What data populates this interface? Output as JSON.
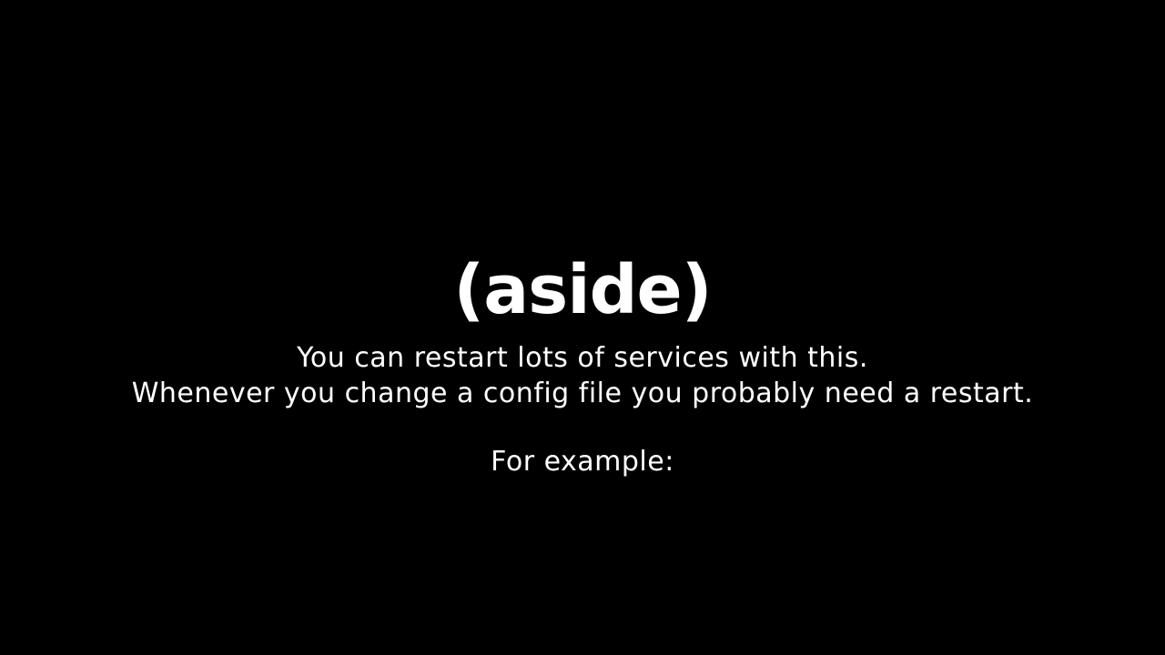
{
  "slide": {
    "title": "(aside)",
    "body_lines": [
      "You can restart lots of services with this.",
      "Whenever you change a config file you probably need a restart.",
      "For example:"
    ],
    "background_color": "#000000",
    "text_color": "#ffffff"
  }
}
